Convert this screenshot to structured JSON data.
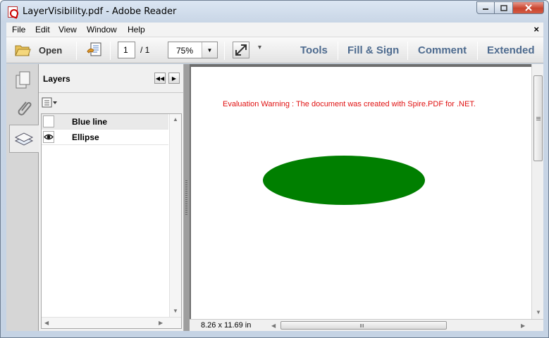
{
  "window": {
    "title": "LayerVisibility.pdf - Adobe Reader"
  },
  "menu": {
    "items": [
      "File",
      "Edit",
      "View",
      "Window",
      "Help"
    ],
    "close_glyph": "×"
  },
  "toolbar": {
    "open_label": "Open",
    "page_current": "1",
    "page_total": "/ 1",
    "zoom": "75%",
    "links": [
      "Tools",
      "Fill & Sign",
      "Comment",
      "Extended"
    ]
  },
  "layers_panel": {
    "title": "Layers",
    "layers": [
      {
        "name": "Blue line",
        "visible": false
      },
      {
        "name": "Ellipse",
        "visible": true
      }
    ]
  },
  "document": {
    "warning": "Evaluation Warning : The document was created with Spire.PDF for .NET.",
    "ellipse_color": "#007f00",
    "page_size": "8.26 x 11.69 in"
  },
  "icons": {
    "title": "pdf-document-icon",
    "open": "folder-open-icon",
    "create": "create-pdf-icon",
    "fit": "fit-page-icon",
    "nav": [
      "pages-icon",
      "attachments-icon",
      "layers-icon"
    ],
    "eye": "eye-icon"
  }
}
